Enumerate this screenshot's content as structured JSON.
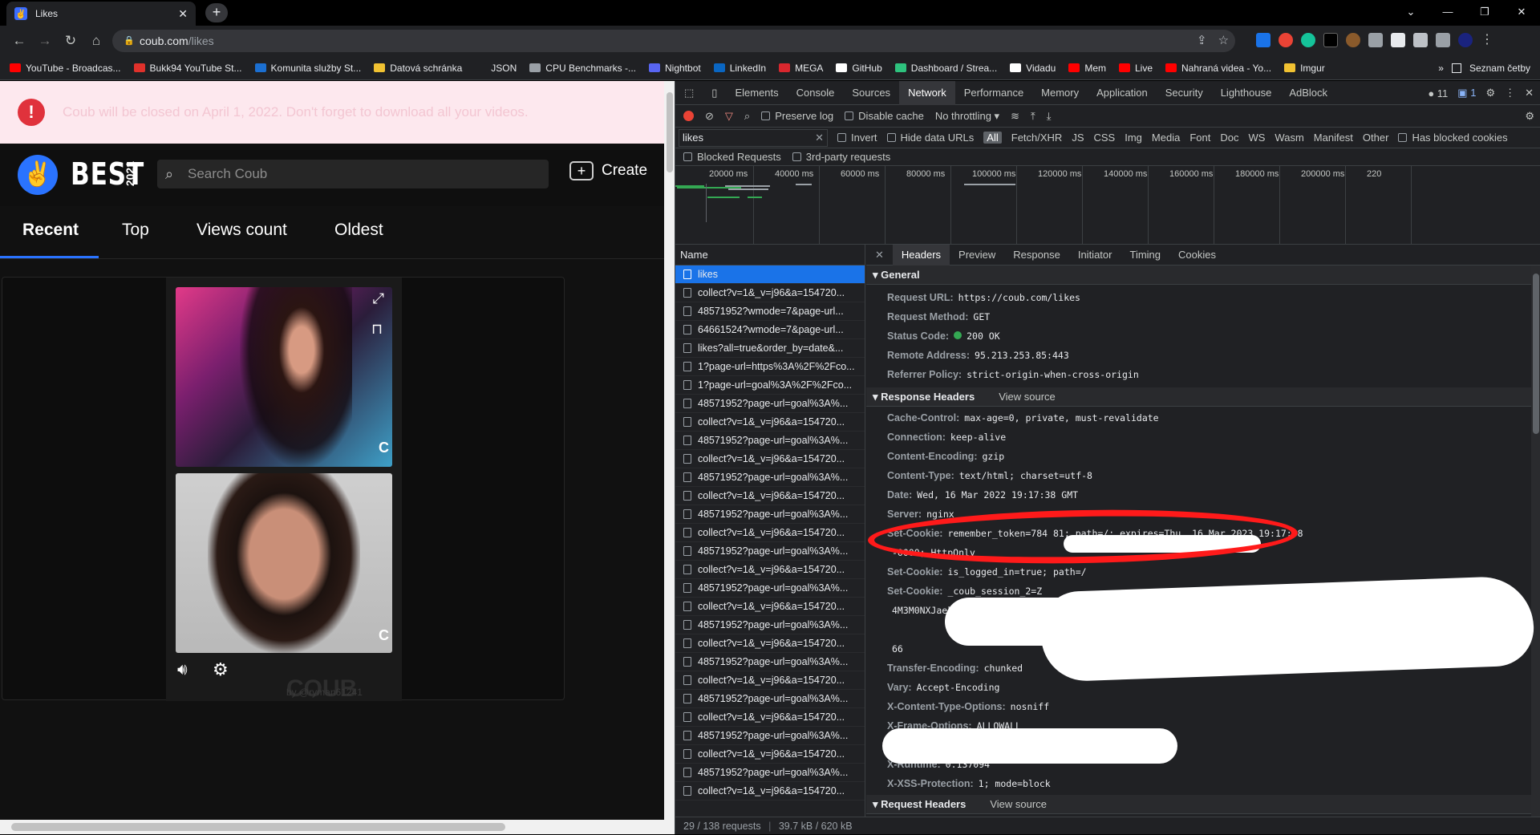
{
  "browser": {
    "tab_title": "Likes",
    "new_tab": "+",
    "url_host": "coub.com",
    "url_path": "/likes",
    "bookmarks": [
      {
        "label": "YouTube - Broadcas...",
        "color": "#ff0000"
      },
      {
        "label": "Bukk94 YouTube St...",
        "color": "#e0312b"
      },
      {
        "label": "Komunita služby St...",
        "color": "#1b6fd1"
      },
      {
        "label": "Datová schránka",
        "color": "#f1c232"
      },
      {
        "label": "JSON",
        "color": "#202124"
      },
      {
        "label": "CPU Benchmarks -...",
        "color": "#9aa0a6"
      },
      {
        "label": "Nightbot",
        "color": "#5865f2"
      },
      {
        "label": "LinkedIn",
        "color": "#0a66c2"
      },
      {
        "label": "MEGA",
        "color": "#d9272e"
      },
      {
        "label": "GitHub",
        "color": "#ffffff"
      },
      {
        "label": "Dashboard / Strea...",
        "color": "#2ec27e"
      },
      {
        "label": "Vidadu",
        "color": "#ffffff"
      },
      {
        "label": "Mem",
        "color": "#ff0000"
      },
      {
        "label": "Live",
        "color": "#ff0000"
      },
      {
        "label": "Nahraná videa - Yo...",
        "color": "#ff0000"
      },
      {
        "label": "Imgur",
        "color": "#f1c232"
      }
    ],
    "bookmarks_more": "»",
    "reading_list": "Seznam četby"
  },
  "coub": {
    "notice": "Coub will be closed on April 1, 2022. Don't forget to download all your videos.",
    "logo_text": "BEST",
    "logo_year": "2021",
    "search_placeholder": "Search Coub",
    "create_label": "Create",
    "tabs": [
      "Recent",
      "Top",
      "Views count",
      "Oldest"
    ],
    "active_tab": "Recent",
    "watermark": "COUB",
    "username": "by @ryman61241"
  },
  "devtools": {
    "tabs": [
      "Elements",
      "Console",
      "Sources",
      "Network",
      "Performance",
      "Memory",
      "Application",
      "Security",
      "Lighthouse",
      "AdBlock"
    ],
    "active_tab": "Network",
    "issues_count": "11",
    "messages_count": "1",
    "preserve_log": "Preserve log",
    "disable_cache": "Disable cache",
    "throttling": "No throttling",
    "filter_value": "likes",
    "invert": "Invert",
    "hide_data_urls": "Hide data URLs",
    "types": [
      "All",
      "Fetch/XHR",
      "JS",
      "CSS",
      "Img",
      "Media",
      "Font",
      "Doc",
      "WS",
      "Wasm",
      "Manifest",
      "Other"
    ],
    "has_blocked_cookies": "Has blocked cookies",
    "blocked_requests": "Blocked Requests",
    "third_party": "3rd-party requests",
    "timeline_ticks": [
      "20000 ms",
      "40000 ms",
      "60000 ms",
      "80000 ms",
      "100000 ms",
      "120000 ms",
      "140000 ms",
      "160000 ms",
      "180000 ms",
      "200000 ms",
      "220"
    ],
    "name_header": "Name",
    "requests": [
      "likes",
      "collect?v=1&_v=j96&a=154720...",
      "48571952?wmode=7&page-url...",
      "64661524?wmode=7&page-url...",
      "likes?all=true&order_by=date&...",
      "1?page-url=https%3A%2F%2Fco...",
      "1?page-url=goal%3A%2F%2Fco...",
      "48571952?page-url=goal%3A%...",
      "collect?v=1&_v=j96&a=154720...",
      "48571952?page-url=goal%3A%...",
      "collect?v=1&_v=j96&a=154720...",
      "48571952?page-url=goal%3A%...",
      "collect?v=1&_v=j96&a=154720...",
      "48571952?page-url=goal%3A%...",
      "collect?v=1&_v=j96&a=154720...",
      "48571952?page-url=goal%3A%...",
      "collect?v=1&_v=j96&a=154720...",
      "48571952?page-url=goal%3A%...",
      "collect?v=1&_v=j96&a=154720...",
      "48571952?page-url=goal%3A%...",
      "collect?v=1&_v=j96&a=154720...",
      "48571952?page-url=goal%3A%...",
      "collect?v=1&_v=j96&a=154720...",
      "48571952?page-url=goal%3A%...",
      "collect?v=1&_v=j96&a=154720...",
      "48571952?page-url=goal%3A%...",
      "collect?v=1&_v=j96&a=154720...",
      "48571952?page-url=goal%3A%...",
      "collect?v=1&_v=j96&a=154720..."
    ],
    "status_requests": "29 / 138 requests",
    "status_size": "39.7 kB / 620 kB",
    "detail_tabs": [
      "Headers",
      "Preview",
      "Response",
      "Initiator",
      "Timing",
      "Cookies"
    ],
    "general_title": "General",
    "general": [
      {
        "k": "Request URL:",
        "v": "https://coub.com/likes"
      },
      {
        "k": "Request Method:",
        "v": "GET"
      },
      {
        "k": "Status Code:",
        "v": "200 OK"
      },
      {
        "k": "Remote Address:",
        "v": "95.213.253.85:443"
      },
      {
        "k": "Referrer Policy:",
        "v": "strict-origin-when-cross-origin"
      }
    ],
    "response_title": "Response Headers",
    "view_source": "View source",
    "response": [
      {
        "k": "Cache-Control:",
        "v": "max-age=0, private, must-revalidate"
      },
      {
        "k": "Connection:",
        "v": "keep-alive"
      },
      {
        "k": "Content-Encoding:",
        "v": "gzip"
      },
      {
        "k": "Content-Type:",
        "v": "text/html; charset=utf-8"
      },
      {
        "k": "Date:",
        "v": "Wed, 16 Mar 2022 19:17:38 GMT"
      },
      {
        "k": "Server:",
        "v": "nginx"
      },
      {
        "k": "Set-Cookie:",
        "v": "remember_token=784                                   81; path=/; expires=Thu, 16 Mar 2023 19:17:38"
      },
      {
        "k": "",
        "v": "-0000; HttpOnly"
      },
      {
        "k": "Set-Cookie:",
        "v": "is_logged_in=true; path=/"
      },
      {
        "k": "Set-Cookie:",
        "v": "_coub_session_2=Z"
      },
      {
        "k": "",
        "v": "4M3M0NXJaek"
      },
      {
        "k": "",
        "v": ""
      },
      {
        "k": "",
        "v": "66"
      },
      {
        "k": "Transfer-Encoding:",
        "v": "chunked"
      },
      {
        "k": "Vary:",
        "v": "Accept-Encoding"
      },
      {
        "k": "X-Content-Type-Options:",
        "v": "nosniff"
      },
      {
        "k": "X-Frame-Options:",
        "v": "ALLOWALL"
      },
      {
        "k": "",
        "v": ""
      },
      {
        "k": "X-Runtime:",
        "v": "0.137094"
      },
      {
        "k": "X-XSS-Protection:",
        "v": "1; mode=block"
      }
    ],
    "request_title": "Request Headers"
  }
}
